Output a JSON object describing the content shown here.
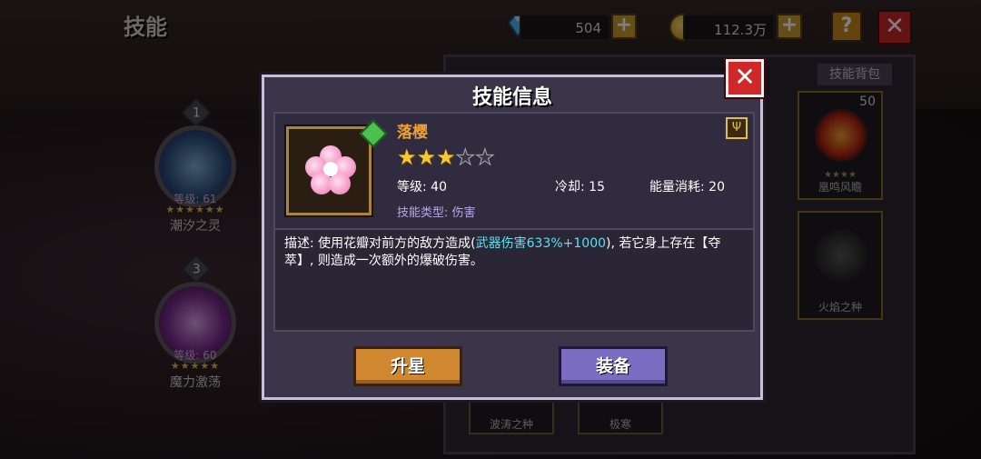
{
  "scene": {
    "title": "技能",
    "currency": {
      "gems": "504",
      "coins": "112.3万"
    },
    "plus_label": "+",
    "help_label": "?",
    "close_label": "✕"
  },
  "slots": [
    {
      "number": "1",
      "level": "等级: 61",
      "stars": "★★★★★★",
      "name": "潮汐之灵"
    },
    {
      "number": "3",
      "level": "等级: 60",
      "stars": "★★★★★",
      "name": "魔力激荡"
    }
  ],
  "inventory": {
    "tab_label": "技能背包",
    "items": [
      {
        "name": "凰鸣风瞻",
        "count": "50",
        "stars": "★★★★"
      },
      {
        "name": "火焰之种",
        "count": "",
        "stars": ""
      }
    ],
    "bottom_items": [
      "波涛之种",
      "极寒"
    ]
  },
  "dialog": {
    "title": "技能信息",
    "close_label": "✕",
    "skill": {
      "name": "落樱",
      "stars_filled": 3,
      "stars_total": 5,
      "level": "等级: 40",
      "cooldown": "冷却: 15",
      "energy": "能量消耗: 20",
      "type": "技能类型: 伤害",
      "type_badge": "Ψ",
      "desc_before": "描述: 使用花瓣对前方的敌方造成(",
      "desc_highlight": "武器伤害633%+1000",
      "desc_after": "), 若它身上存在【夺萃】, 则造成一次额外的爆破伤害。"
    },
    "buttons": {
      "upgrade": "升星",
      "equip": "装备"
    }
  },
  "colors": {
    "highlight": "#5ae0f0",
    "skill_name": "#f0a030",
    "upgrade_button": "#d08830",
    "equip_button": "#7a6cc0",
    "close_button": "#d02828"
  }
}
